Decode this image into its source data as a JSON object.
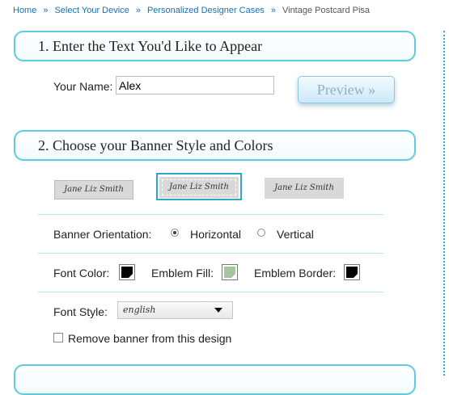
{
  "breadcrumb": {
    "home": "Home",
    "separator": "»",
    "device": "Select Your Device",
    "cases": "Personalized Designer Cases",
    "current": "Vintage Postcard Pisa"
  },
  "step1": {
    "title": "1. Enter the Text You'd Like to Appear",
    "name_label": "Your Name:",
    "name_value": "Alex",
    "preview_label": "Preview »"
  },
  "step2": {
    "title": "2. Choose your Banner Style and Colors",
    "banner_options": [
      "Jane Liz Smith",
      "Jane Liz Smith",
      "Jane Liz Smith"
    ],
    "selected_banner_index": 1,
    "orientation_label": "Banner Orientation:",
    "orientation_horizontal": "Horizontal",
    "orientation_vertical": "Vertical",
    "orientation_selected": "Horizontal",
    "font_color_label": "Font Color:",
    "emblem_fill_label": "Emblem Fill:",
    "emblem_border_label": "Emblem Border:",
    "font_style_label": "Font Style:",
    "font_style_value": "english",
    "remove_banner_label": "Remove banner from this design",
    "remove_banner_checked": false
  },
  "colors": {
    "accent": "#2aa9c9",
    "font_color": "#000000",
    "emblem_fill": "#a7c4a0",
    "emblem_border": "#000000"
  }
}
